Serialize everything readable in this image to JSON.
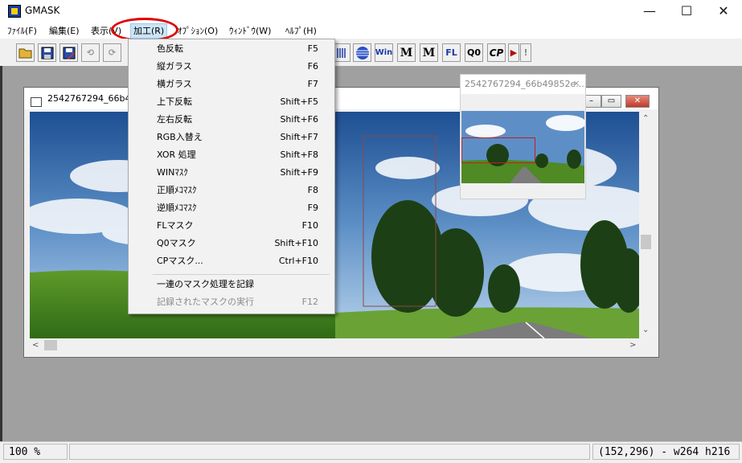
{
  "window": {
    "title": "GMASK",
    "minimize_glyph": "—",
    "maximize_glyph": "☐",
    "close_glyph": "✕",
    "accent": "#e00000"
  },
  "menubar": {
    "items": [
      "ﾌｧｲﾙ(F)",
      "編集(E)",
      "表示(V)",
      "加工(R)",
      "ｵﾌﾟｼｮﾝ(O)",
      "ｳｨﾝﾄﾞｳ(W)",
      "ﾍﾙﾌﾟ(H)"
    ]
  },
  "toolbar": {
    "buttons": [
      "open-folder-icon",
      "save-disk-icon",
      "save-as-icon",
      "undo-icon",
      "redo-icon",
      "lines-icon",
      "circle-icon",
      "win-mask",
      "m-mask",
      "m-star-mask",
      "fl-mask",
      "q0-mask",
      "cp-mask",
      "play-icon",
      "exclamation-icon"
    ],
    "labels": {
      "win": "Win",
      "m1": "M",
      "m2": "M",
      "fl": "FL",
      "q0": "Q0",
      "cp": "CP",
      "excl": "!"
    }
  },
  "dropdown": {
    "items": [
      {
        "label": "色反転",
        "shortcut": "F5",
        "enabled": true
      },
      {
        "label": "縦ガラス",
        "shortcut": "F6",
        "enabled": true
      },
      {
        "label": "横ガラス",
        "shortcut": "F7",
        "enabled": true
      },
      {
        "label": "上下反転",
        "shortcut": "Shift+F5",
        "enabled": true
      },
      {
        "label": "左右反転",
        "shortcut": "Shift+F6",
        "enabled": true
      },
      {
        "label": "RGB入替え",
        "shortcut": "Shift+F7",
        "enabled": true
      },
      {
        "label": "XOR 処理",
        "shortcut": "Shift+F8",
        "enabled": true
      },
      {
        "label": "WINﾏｽｸ",
        "shortcut": "Shift+F9",
        "enabled": true
      },
      {
        "label": "正順ﾒｺﾏｽｸ",
        "shortcut": "F8",
        "enabled": true
      },
      {
        "label": "逆順ﾒｺﾏｽｸ",
        "shortcut": "F9",
        "enabled": true
      },
      {
        "label": "FLマスク",
        "shortcut": "F10",
        "enabled": true
      },
      {
        "label": "Q0マスク",
        "shortcut": "Shift+F10",
        "enabled": true
      },
      {
        "label": "CPマスク...",
        "shortcut": "Ctrl+F10",
        "enabled": true
      },
      {
        "label": "一連のマスク処理を記録",
        "shortcut": "",
        "enabled": true
      },
      {
        "label": "記録されたマスクの実行",
        "shortcut": "F12",
        "enabled": false
      }
    ]
  },
  "child_window": {
    "title": "2542767294_66b498"
  },
  "navigator": {
    "title": "2542767294_66b49852e...",
    "close_glyph": "×"
  },
  "statusbar": {
    "zoom": "100 %",
    "message": "",
    "coords": "(152,296) - w264 h216"
  }
}
